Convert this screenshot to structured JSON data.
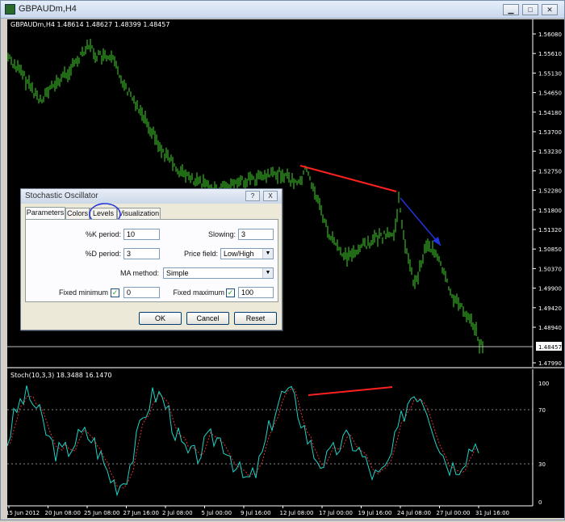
{
  "window": {
    "title": "GBPAUDm,H4"
  },
  "chart": {
    "header": "GBPAUDm,H4  1.48614 1.48627 1.48399 1.48457",
    "price_ticks": [
      "1.56080",
      "1.55610",
      "1.55130",
      "1.54650",
      "1.54180",
      "1.53700",
      "1.53230",
      "1.52750",
      "1.52280",
      "1.51800",
      "1.51320",
      "1.50850",
      "1.50370",
      "1.49900",
      "1.49420",
      "1.48940",
      "1.48457",
      "1.47990"
    ],
    "current_price": "1.48457",
    "indicator_header": "Stoch(10,3,3) 18.3488 16.1470",
    "osc_ticks": [
      "100",
      "70",
      "30",
      "0"
    ],
    "time_ticks": [
      "15 Jun 2012",
      "20 Jun 08:00",
      "25 Jun 08:00",
      "27 Jun 16:00",
      "2 Jul 08:00",
      "5 Jul 00:00",
      "9 Jul 16:00",
      "12 Jul 08:00",
      "17 Jul 00:00",
      "19 Jul 16:00",
      "24 Jul 08:00",
      "27 Jul 00:00",
      "31 Jul 16:00"
    ],
    "colors": {
      "bars": "#44d62c",
      "main": "#1fd3c7",
      "signal": "#e03030",
      "annotation_red": "#ff2020",
      "annotation_blue": "#2233dd"
    }
  },
  "dialog": {
    "title": "Stochastic Oscillator",
    "help_label": "?",
    "close_label": "X",
    "tabs": [
      "Parameters",
      "Colors",
      "Levels",
      "Visualization"
    ],
    "k_period_label": "%K period:",
    "k_period": "10",
    "slowing_label": "Slowing:",
    "slowing": "3",
    "d_period_label": "%D period:",
    "d_period": "3",
    "price_field_label": "Price field:",
    "price_field": "Low/High",
    "ma_method_label": "MA method:",
    "ma_method": "Simple",
    "fixed_min_label": "Fixed minimum",
    "fixed_min": "0",
    "fixed_max_label": "Fixed maximum",
    "fixed_max": "100",
    "ok": "OK",
    "cancel": "Cancel",
    "reset": "Reset"
  }
}
